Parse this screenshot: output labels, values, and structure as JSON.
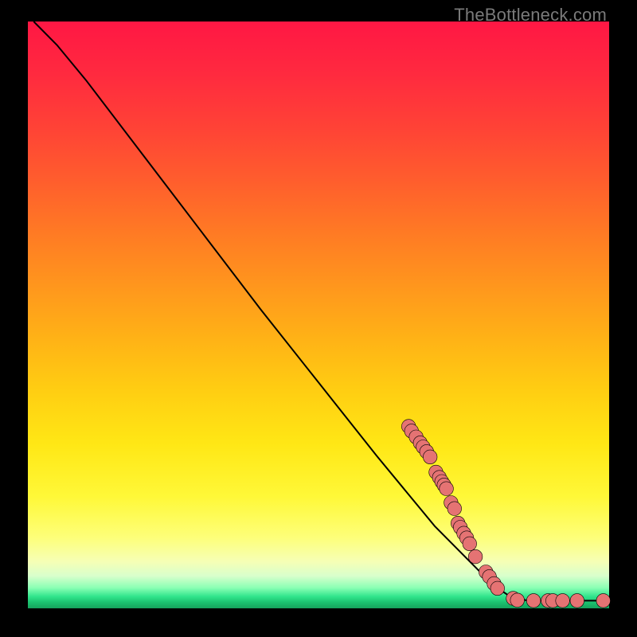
{
  "watermark": "TheBottleneck.com",
  "colors": {
    "marker_fill": "#e57373",
    "marker_stroke": "#000000",
    "line_stroke": "#000000",
    "background": "#000000"
  },
  "chart_data": {
    "type": "line",
    "title": "",
    "xlabel": "",
    "ylabel": "",
    "xlim": [
      0,
      100
    ],
    "ylim": [
      0,
      100
    ],
    "line_points": [
      {
        "x": 1,
        "y": 100
      },
      {
        "x": 5,
        "y": 96
      },
      {
        "x": 10,
        "y": 90
      },
      {
        "x": 20,
        "y": 77
      },
      {
        "x": 30,
        "y": 64
      },
      {
        "x": 40,
        "y": 51
      },
      {
        "x": 50,
        "y": 38.5
      },
      {
        "x": 60,
        "y": 26
      },
      {
        "x": 70,
        "y": 14
      },
      {
        "x": 80,
        "y": 4
      },
      {
        "x": 83,
        "y": 2
      },
      {
        "x": 86,
        "y": 1.3
      },
      {
        "x": 100,
        "y": 1.3
      }
    ],
    "markers": [
      {
        "x": 65.5,
        "y": 31.0
      },
      {
        "x": 66.0,
        "y": 30.2
      },
      {
        "x": 66.8,
        "y": 29.2
      },
      {
        "x": 67.5,
        "y": 28.2
      },
      {
        "x": 68.0,
        "y": 27.5
      },
      {
        "x": 68.6,
        "y": 26.7
      },
      {
        "x": 69.2,
        "y": 25.8
      },
      {
        "x": 70.2,
        "y": 23.2
      },
      {
        "x": 70.8,
        "y": 22.3
      },
      {
        "x": 71.2,
        "y": 21.6
      },
      {
        "x": 71.6,
        "y": 21.0
      },
      {
        "x": 72.0,
        "y": 20.4
      },
      {
        "x": 72.8,
        "y": 18.0
      },
      {
        "x": 73.4,
        "y": 17.0
      },
      {
        "x": 74.0,
        "y": 14.5
      },
      {
        "x": 74.4,
        "y": 13.8
      },
      {
        "x": 75.0,
        "y": 12.8
      },
      {
        "x": 75.5,
        "y": 12.0
      },
      {
        "x": 76.0,
        "y": 11.0
      },
      {
        "x": 77.0,
        "y": 8.8
      },
      {
        "x": 78.8,
        "y": 6.2
      },
      {
        "x": 79.4,
        "y": 5.4
      },
      {
        "x": 80.2,
        "y": 4.2
      },
      {
        "x": 80.8,
        "y": 3.4
      },
      {
        "x": 83.5,
        "y": 1.7
      },
      {
        "x": 84.2,
        "y": 1.4
      },
      {
        "x": 87.0,
        "y": 1.3
      },
      {
        "x": 89.5,
        "y": 1.3
      },
      {
        "x": 90.3,
        "y": 1.3
      },
      {
        "x": 92.0,
        "y": 1.3
      },
      {
        "x": 94.5,
        "y": 1.3
      },
      {
        "x": 99.0,
        "y": 1.3
      }
    ],
    "marker_radius_data_units": 1.2
  }
}
